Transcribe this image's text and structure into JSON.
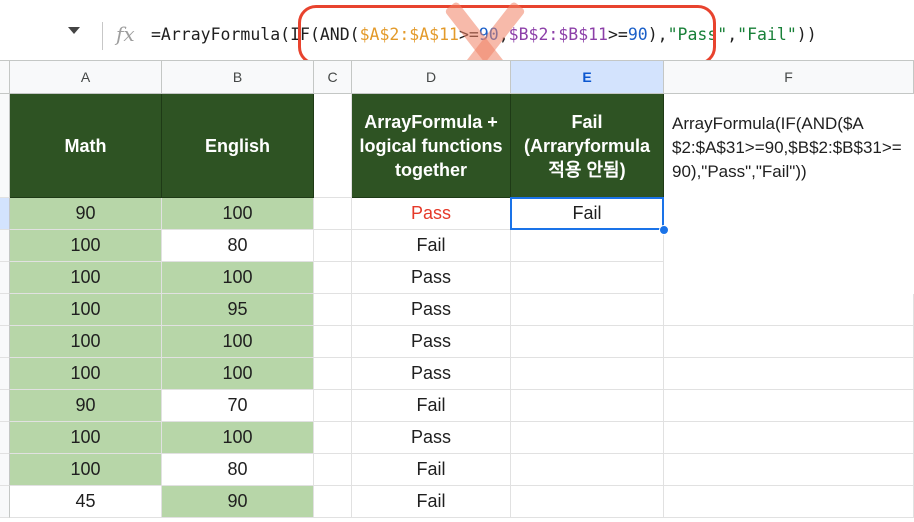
{
  "formula_bar": {
    "fx_label": "fx",
    "formula_parts": [
      {
        "text": "=ArrayFormula(IF(AND(",
        "kind": "plain"
      },
      {
        "text": "$A$2:$A$11",
        "kind": "ref1"
      },
      {
        "text": ">=",
        "kind": "plain"
      },
      {
        "text": "90",
        "kind": "num"
      },
      {
        "text": ",",
        "kind": "plain"
      },
      {
        "text": "$B$2:$B$11",
        "kind": "ref2"
      },
      {
        "text": ">=",
        "kind": "plain"
      },
      {
        "text": "90",
        "kind": "num"
      },
      {
        "text": "),",
        "kind": "plain"
      },
      {
        "text": "\"Pass\"",
        "kind": "str"
      },
      {
        "text": ",",
        "kind": "plain"
      },
      {
        "text": "\"Fail\"",
        "kind": "str"
      },
      {
        "text": "))",
        "kind": "plain"
      }
    ]
  },
  "columns": [
    "A",
    "B",
    "C",
    "D",
    "E",
    "F"
  ],
  "selected_column": "E",
  "headers": {
    "A": "Math",
    "B": "English",
    "D": "ArrayFormula + logical functions together",
    "E": "Fail (Arraryformula 적용 안됨)",
    "F": "ArrayFormula(IF(AND($A$2:$A$31>=90,$B$2:$B$31>=90),\"Pass\",\"Fail\"))"
  },
  "rows": [
    {
      "math": "90",
      "english": "100",
      "d": "Pass",
      "e": "Fail",
      "math_green": true,
      "english_green": true,
      "d_red": true
    },
    {
      "math": "100",
      "english": "80",
      "d": "Fail",
      "e": "",
      "math_green": true,
      "english_green": false,
      "d_red": false
    },
    {
      "math": "100",
      "english": "100",
      "d": "Pass",
      "e": "",
      "math_green": true,
      "english_green": true,
      "d_red": false
    },
    {
      "math": "100",
      "english": "95",
      "d": "Pass",
      "e": "",
      "math_green": true,
      "english_green": true,
      "d_red": false
    },
    {
      "math": "100",
      "english": "100",
      "d": "Pass",
      "e": "",
      "math_green": true,
      "english_green": true,
      "d_red": false
    },
    {
      "math": "100",
      "english": "100",
      "d": "Pass",
      "e": "",
      "math_green": true,
      "english_green": true,
      "d_red": false
    },
    {
      "math": "90",
      "english": "70",
      "d": "Fail",
      "e": "",
      "math_green": true,
      "english_green": false,
      "d_red": false
    },
    {
      "math": "100",
      "english": "100",
      "d": "Pass",
      "e": "",
      "math_green": true,
      "english_green": true,
      "d_red": false
    },
    {
      "math": "100",
      "english": "80",
      "d": "Fail",
      "e": "",
      "math_green": true,
      "english_green": false,
      "d_red": false
    },
    {
      "math": "45",
      "english": "90",
      "d": "Fail",
      "e": "",
      "math_green": false,
      "english_green": true,
      "d_red": false
    }
  ],
  "colors": {
    "header_green": "#2e5323",
    "cell_green": "#b7d6a8",
    "pass_red": "#e53929",
    "selection_blue": "#1a73e8",
    "annotation_red": "#e8432e"
  }
}
